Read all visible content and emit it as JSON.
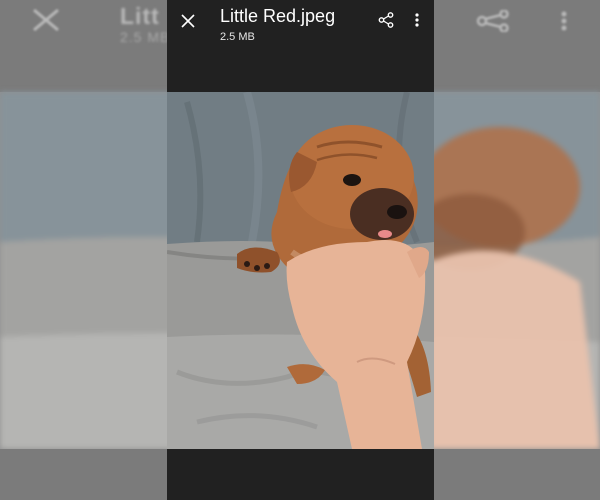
{
  "viewer": {
    "title": "Little Red.jpeg",
    "file_size": "2.5 MB",
    "close_icon": "close-icon",
    "share_icon": "share-icon",
    "more_icon": "more-vertical-icon"
  },
  "background": {
    "title_fragment": "Litt",
    "size_fragment": "2.5 MB"
  },
  "photo": {
    "subject": "photo",
    "colors": {
      "backdrop": "#6f7a80",
      "blanket": "#9a9a98",
      "puppy": "#b06a3a",
      "skin": "#e7b497",
      "chrome": "#212121"
    }
  }
}
